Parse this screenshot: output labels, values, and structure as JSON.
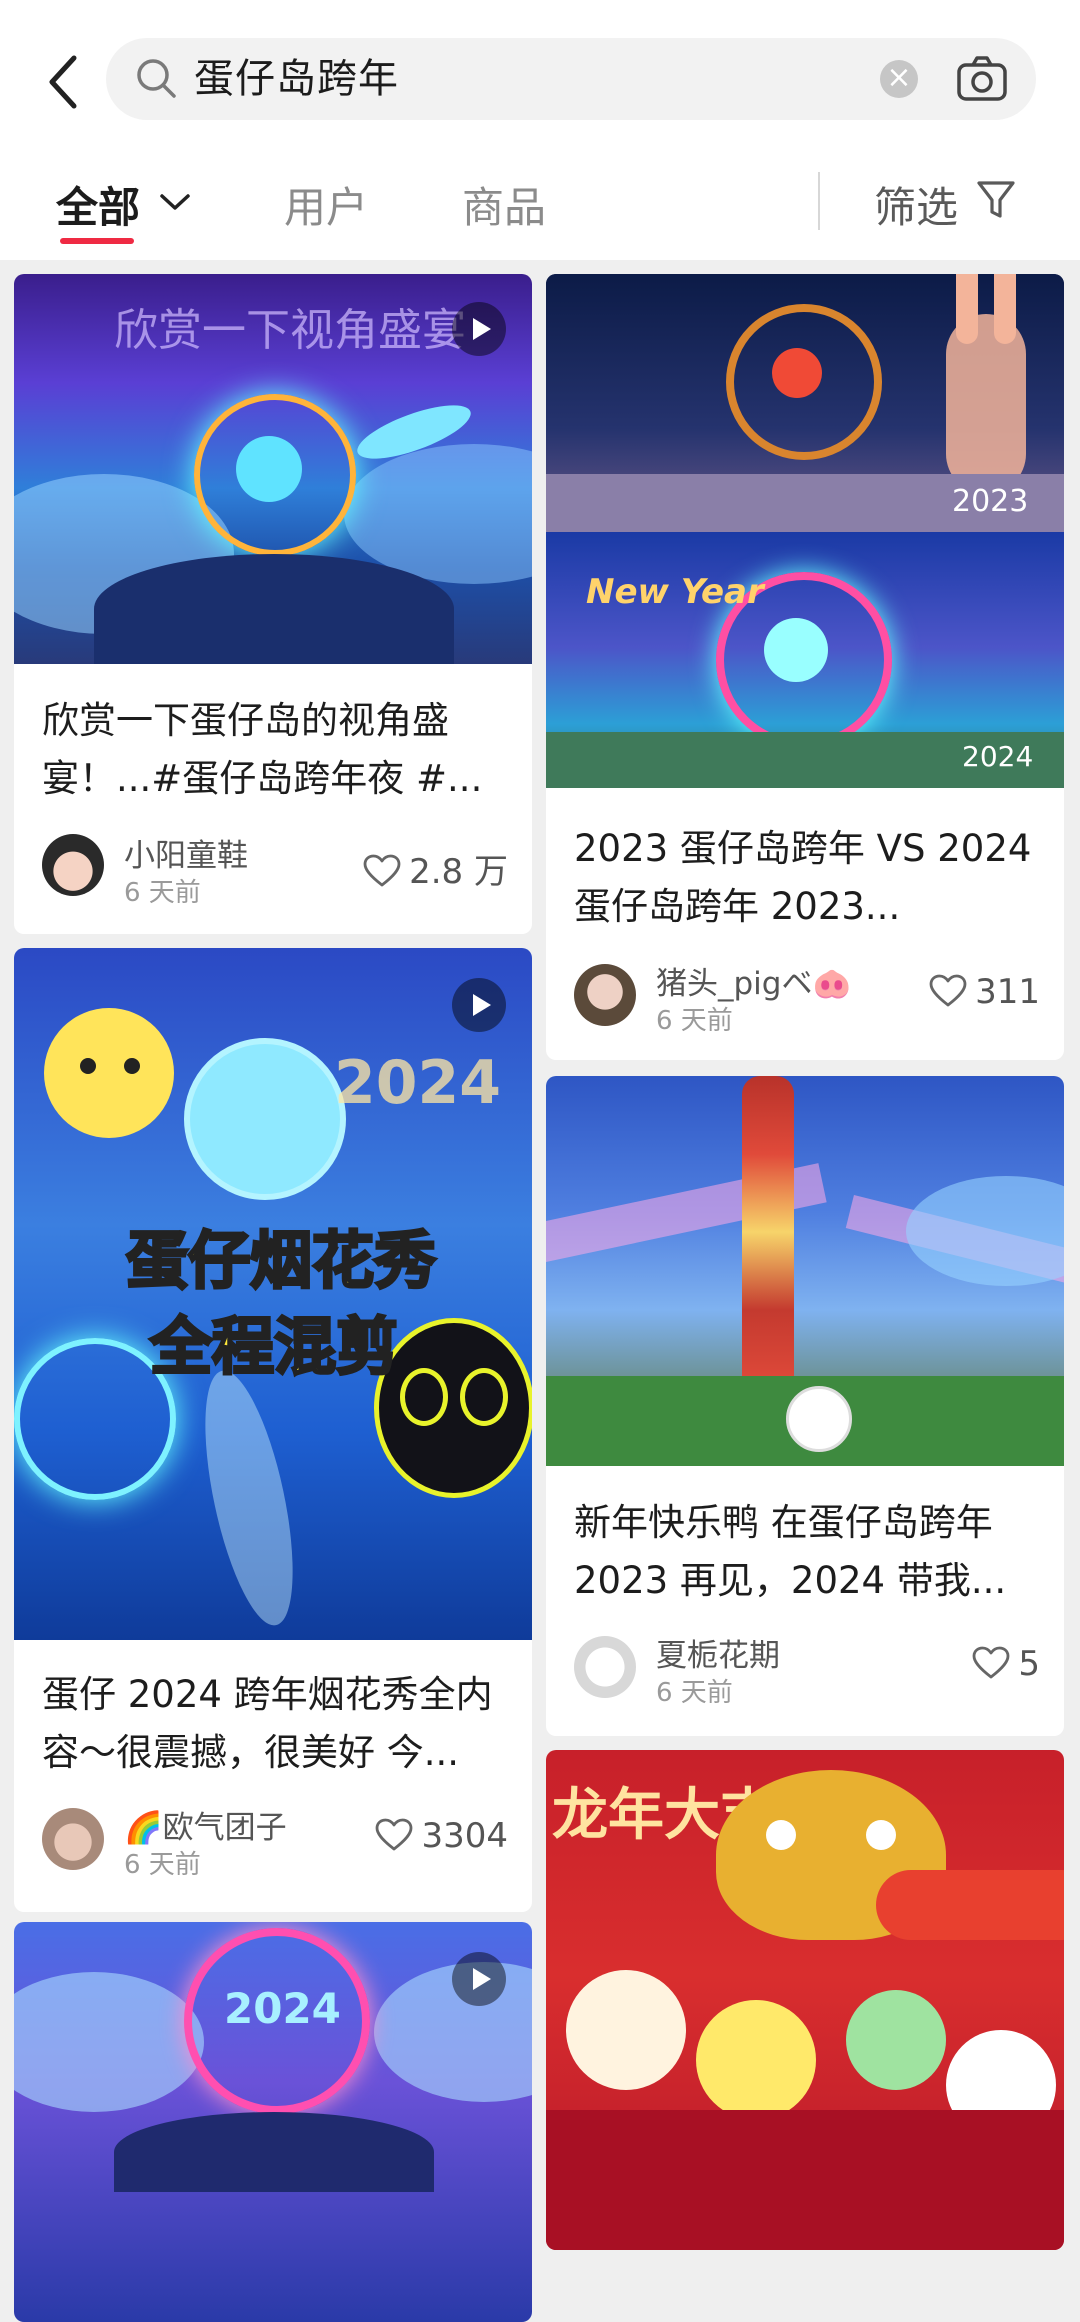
{
  "search": {
    "query": "蛋仔岛跨年"
  },
  "tabs": {
    "all": "全部",
    "users": "用户",
    "products": "商品",
    "filter": "筛选"
  },
  "feed": [
    {
      "title": "欣赏一下蛋仔岛的视角盛宴！...#蛋仔岛跨年夜 #...",
      "author": "小阳童鞋",
      "time": "6 天前",
      "likes": "2.8 万",
      "cover_caption": "欣赏一下视角盛宴"
    },
    {
      "title": "2023 蛋仔岛跨年 VS 2024 蛋仔岛跨年 2023...",
      "author": "猪头_pigベ🐽",
      "time": "6 天前",
      "likes": "311",
      "cover_year_top": "2023",
      "cover_year_bottom": "2024",
      "cover_new_year": "New Year"
    },
    {
      "title": "蛋仔 2024 跨年烟花秀全内容～很震撼，很美好 今...",
      "author": "🌈欧气团子",
      "time": "6 天前",
      "likes": "3304",
      "cover_caption_1": "蛋仔烟花秀",
      "cover_caption_2": "全程混剪",
      "cover_year": "2024"
    },
    {
      "title": "新年快乐鸭 在蛋仔岛跨年 2023 再见，2024 带我...",
      "author": "夏栀花期",
      "time": "6 天前",
      "likes": "5"
    },
    {
      "cover_year": "2024"
    },
    {
      "cover_caption": "龙年大吉"
    }
  ]
}
